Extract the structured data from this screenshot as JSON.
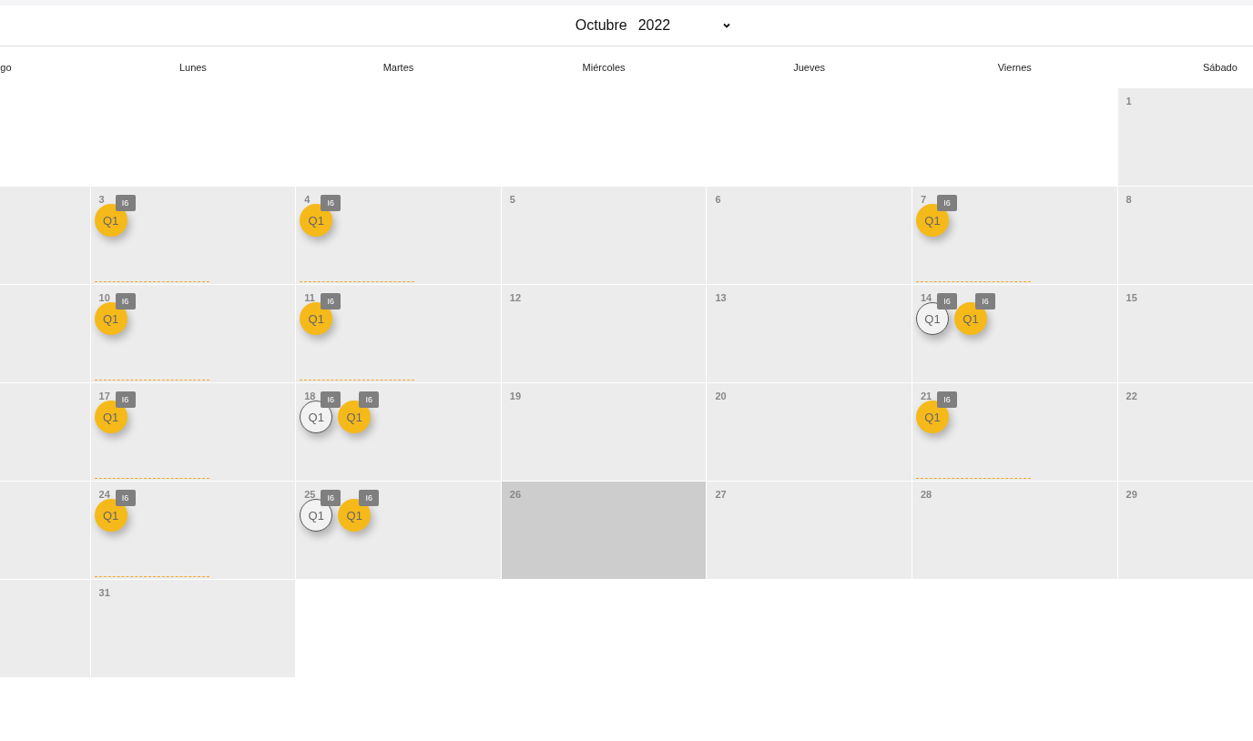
{
  "header": {
    "month": "Octubre",
    "year": "2022"
  },
  "weekdays": [
    "go",
    "Lunes",
    "Martes",
    "Miércoles",
    "Jueves",
    "Viernes",
    "Sábado"
  ],
  "weeks": [
    [
      {
        "kind": "empty"
      },
      {
        "kind": "empty"
      },
      {
        "kind": "empty"
      },
      {
        "kind": "empty"
      },
      {
        "kind": "empty"
      },
      {
        "kind": "empty"
      },
      {
        "kind": "day",
        "day": "1",
        "today": false,
        "underline": false
      }
    ],
    [
      {
        "kind": "day"
      },
      {
        "kind": "day",
        "day": "3",
        "today": false,
        "underline": true,
        "events": [
          {
            "label": "Q1",
            "tag": "I6",
            "filled": true
          }
        ]
      },
      {
        "kind": "day",
        "day": "4",
        "today": false,
        "underline": true,
        "events": [
          {
            "label": "Q1",
            "tag": "I6",
            "filled": true
          }
        ]
      },
      {
        "kind": "day",
        "day": "5",
        "today": false,
        "underline": false
      },
      {
        "kind": "day",
        "day": "6",
        "today": false,
        "underline": false
      },
      {
        "kind": "day",
        "day": "7",
        "today": false,
        "underline": true,
        "events": [
          {
            "label": "Q1",
            "tag": "I6",
            "filled": true
          }
        ]
      },
      {
        "kind": "day",
        "day": "8",
        "today": false,
        "underline": false
      }
    ],
    [
      {
        "kind": "day"
      },
      {
        "kind": "day",
        "day": "10",
        "today": false,
        "underline": true,
        "events": [
          {
            "label": "Q1",
            "tag": "I6",
            "filled": true
          }
        ]
      },
      {
        "kind": "day",
        "day": "11",
        "today": false,
        "underline": true,
        "events": [
          {
            "label": "Q1",
            "tag": "I6",
            "filled": true
          }
        ]
      },
      {
        "kind": "day",
        "day": "12",
        "today": false,
        "underline": false
      },
      {
        "kind": "day",
        "day": "13",
        "today": false,
        "underline": false
      },
      {
        "kind": "day",
        "day": "14",
        "today": false,
        "underline": false,
        "events": [
          {
            "label": "Q1",
            "tag": "I6",
            "filled": false
          },
          {
            "label": "Q1",
            "tag": "I6",
            "filled": true
          }
        ]
      },
      {
        "kind": "day",
        "day": "15",
        "today": false,
        "underline": false
      }
    ],
    [
      {
        "kind": "day"
      },
      {
        "kind": "day",
        "day": "17",
        "today": false,
        "underline": true,
        "events": [
          {
            "label": "Q1",
            "tag": "I6",
            "filled": true
          }
        ]
      },
      {
        "kind": "day",
        "day": "18",
        "today": false,
        "underline": false,
        "events": [
          {
            "label": "Q1",
            "tag": "I6",
            "filled": false
          },
          {
            "label": "Q1",
            "tag": "I6",
            "filled": true
          }
        ]
      },
      {
        "kind": "day",
        "day": "19",
        "today": false,
        "underline": false
      },
      {
        "kind": "day",
        "day": "20",
        "today": false,
        "underline": false
      },
      {
        "kind": "day",
        "day": "21",
        "today": false,
        "underline": true,
        "events": [
          {
            "label": "Q1",
            "tag": "I6",
            "filled": true
          }
        ]
      },
      {
        "kind": "day",
        "day": "22",
        "today": false,
        "underline": false
      }
    ],
    [
      {
        "kind": "day"
      },
      {
        "kind": "day",
        "day": "24",
        "today": false,
        "underline": true,
        "events": [
          {
            "label": "Q1",
            "tag": "I6",
            "filled": true
          }
        ]
      },
      {
        "kind": "day",
        "day": "25",
        "today": false,
        "underline": false,
        "events": [
          {
            "label": "Q1",
            "tag": "I6",
            "filled": false
          },
          {
            "label": "Q1",
            "tag": "I6",
            "filled": true
          }
        ]
      },
      {
        "kind": "day",
        "day": "26",
        "today": true,
        "underline": false
      },
      {
        "kind": "day",
        "day": "27",
        "today": false,
        "underline": false
      },
      {
        "kind": "day",
        "day": "28",
        "today": false,
        "underline": false
      },
      {
        "kind": "day",
        "day": "29",
        "today": false,
        "underline": false
      }
    ],
    [
      {
        "kind": "day"
      },
      {
        "kind": "day",
        "day": "31",
        "today": false,
        "underline": false
      },
      {
        "kind": "empty"
      },
      {
        "kind": "empty"
      },
      {
        "kind": "empty"
      },
      {
        "kind": "empty"
      },
      {
        "kind": "empty"
      }
    ]
  ]
}
